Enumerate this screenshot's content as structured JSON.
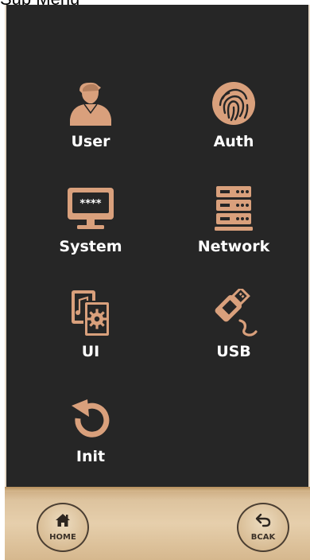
{
  "page": {
    "heading": "Sub Menu"
  },
  "menu": {
    "items": [
      {
        "label": "User",
        "icon": "user-icon"
      },
      {
        "label": "Auth",
        "icon": "fingerprint-icon"
      },
      {
        "label": "System",
        "icon": "monitor-password-icon"
      },
      {
        "label": "Network",
        "icon": "server-icon"
      },
      {
        "label": "UI",
        "icon": "ui-settings-icon"
      },
      {
        "label": "USB",
        "icon": "usb-icon"
      },
      {
        "label": "Init",
        "icon": "reset-icon"
      }
    ]
  },
  "footer": {
    "home_label": "HOME",
    "back_label": "BCAK"
  },
  "colors": {
    "screen_background": "#262626",
    "icon_accent": "#d9a07c",
    "label_text": "#ffffff",
    "bottom_bar": "#e1c7a0"
  }
}
